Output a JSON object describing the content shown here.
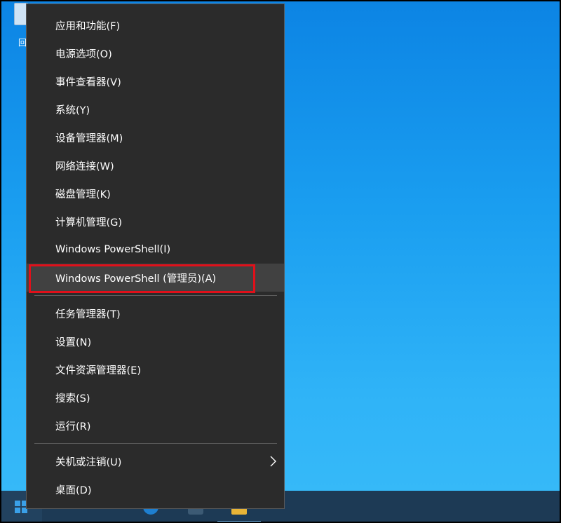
{
  "desktop": {
    "icon_label": "回"
  },
  "context_menu": {
    "items": [
      {
        "label": "应用和功能(F)"
      },
      {
        "label": "电源选项(O)"
      },
      {
        "label": "事件查看器(V)"
      },
      {
        "label": "系统(Y)"
      },
      {
        "label": "设备管理器(M)"
      },
      {
        "label": "网络连接(W)"
      },
      {
        "label": "磁盘管理(K)"
      },
      {
        "label": "计算机管理(G)"
      },
      {
        "label": "Windows PowerShell(I)"
      },
      {
        "label": "Windows PowerShell (管理员)(A)",
        "highlighted": true
      },
      {
        "label": "任务管理器(T)"
      },
      {
        "label": "设置(N)"
      },
      {
        "label": "文件资源管理器(E)"
      },
      {
        "label": "搜索(S)"
      },
      {
        "label": "运行(R)"
      },
      {
        "label": "关机或注销(U)",
        "has_submenu": true
      },
      {
        "label": "桌面(D)"
      }
    ]
  },
  "colors": {
    "menu_background": "#2b2b2b",
    "hover_background": "#414141",
    "highlight_border": "#e0101a",
    "desktop_accent": "#1a9ef0"
  },
  "icons": {
    "submenu": "chevron-right-icon",
    "start": "windows-logo-icon"
  }
}
